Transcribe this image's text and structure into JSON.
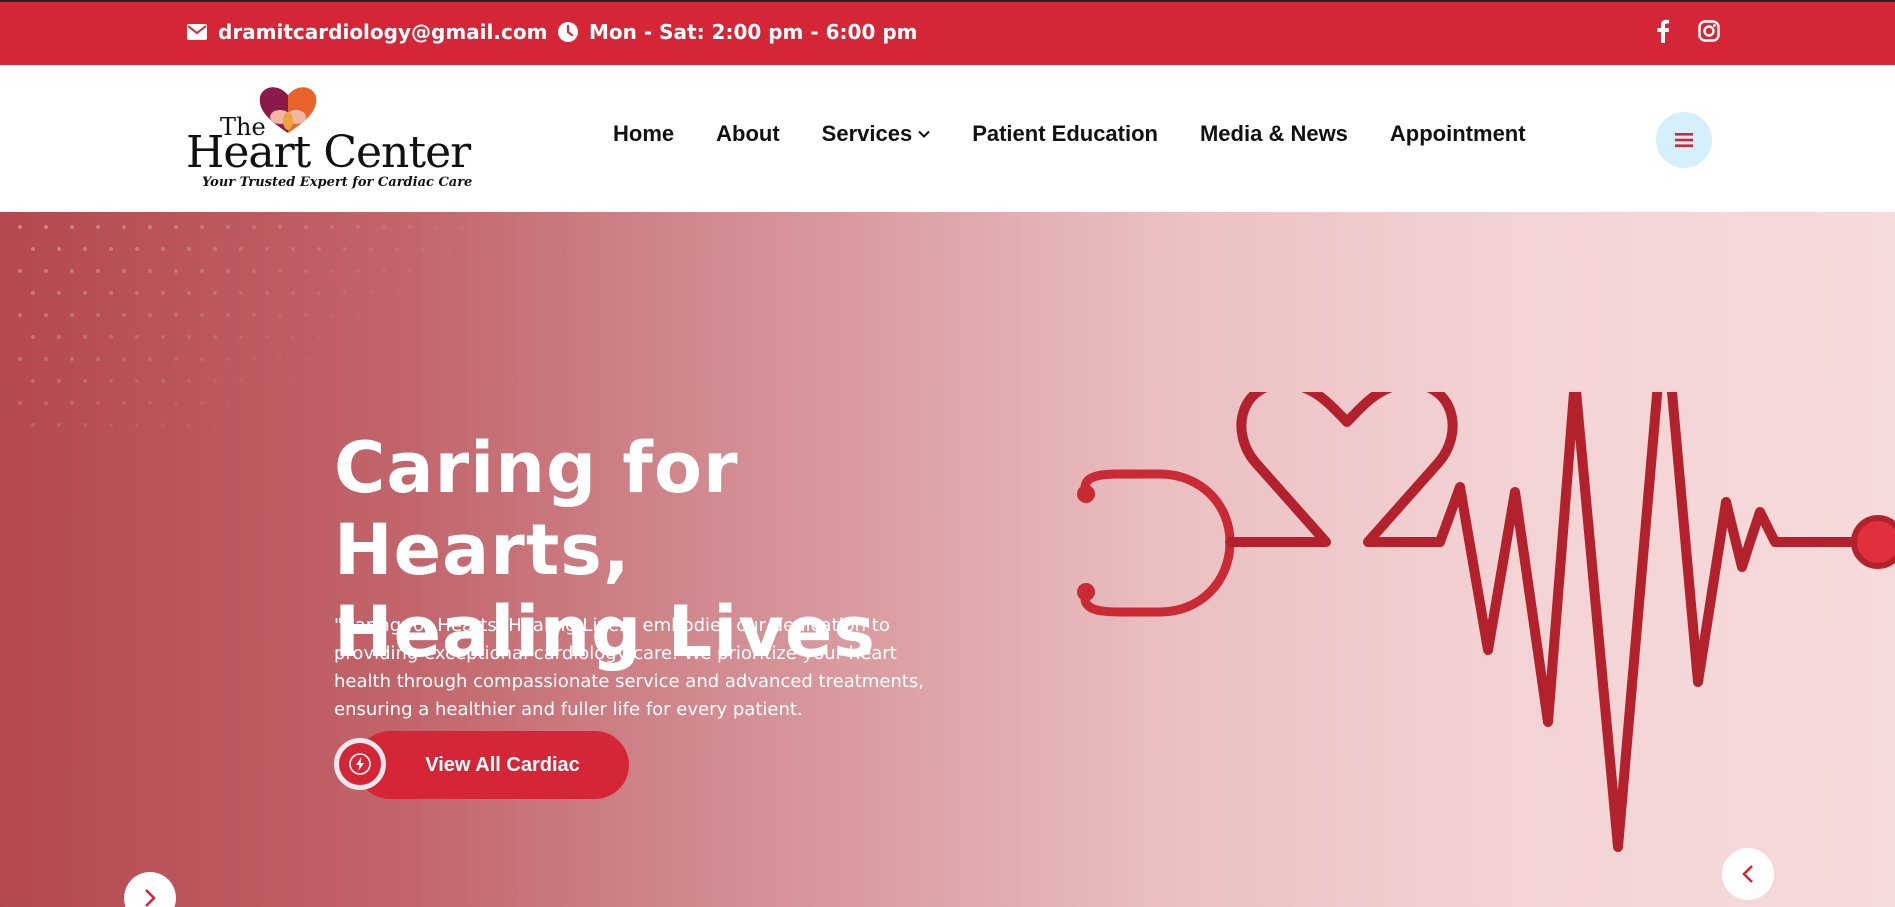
{
  "topbar": {
    "email": "dramitcardiology@gmail.com",
    "hours": "Mon - Sat: 2:00 pm - 6:00 pm",
    "icons": {
      "email": "envelope-icon",
      "hours": "clock-icon",
      "facebook": "facebook-icon",
      "instagram": "instagram-icon"
    }
  },
  "logo": {
    "the": "The",
    "name": "Heart Center",
    "tagline": "Your Trusted Expert for Cardiac Care"
  },
  "nav": {
    "items": [
      "Home",
      "About",
      "Services",
      "Patient Education",
      "Media & News",
      "Appointment"
    ],
    "menu_icon": "hamburger-icon"
  },
  "hero": {
    "title_line1": "Caring for Hearts,",
    "title_line2": "Healing Lives",
    "description": "\"Caring for Hearts, Healing Lives\" embodies our dedication to providing exceptional cardiology care. We prioritize your heart health through compassionate service and advanced treatments, ensuring a healthier and fuller life for every patient.",
    "cta_label": "View All Cardiac",
    "cta_icon": "lightning-icon"
  },
  "colors": {
    "brand_red": "#d42636",
    "menu_bg": "#d6f0fb"
  }
}
